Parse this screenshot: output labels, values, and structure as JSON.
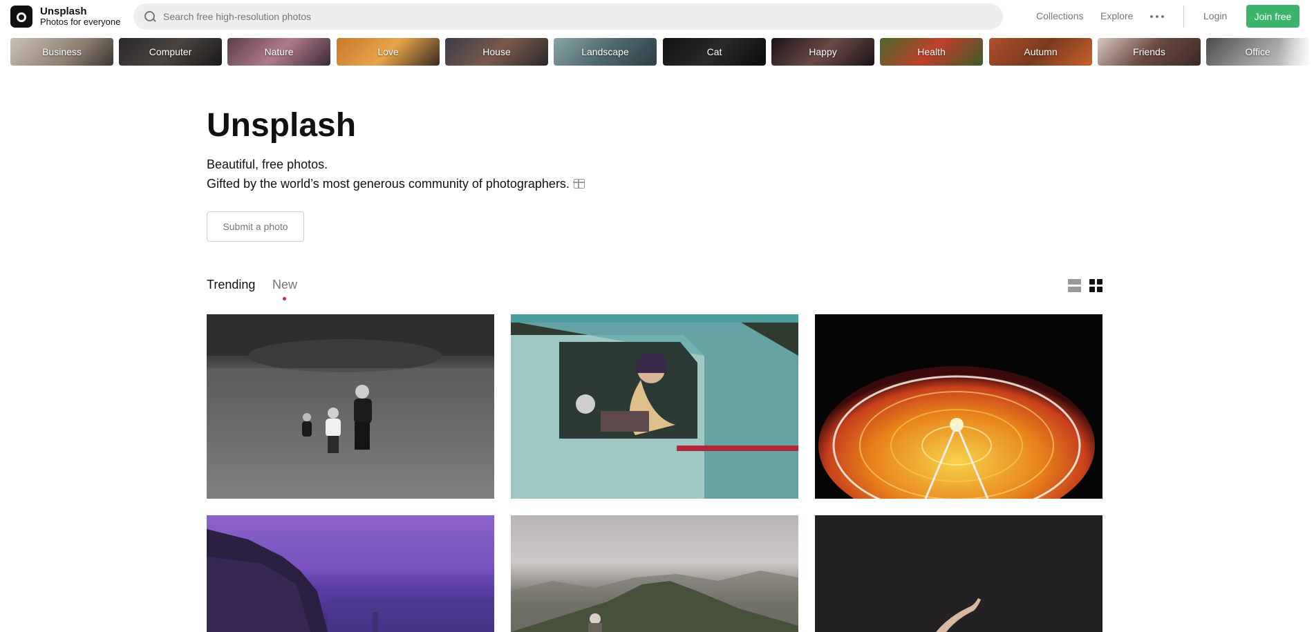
{
  "brand": {
    "title": "Unsplash",
    "subtitle": "Photos for everyone"
  },
  "search": {
    "placeholder": "Search free high-resolution photos"
  },
  "nav": {
    "collections": "Collections",
    "explore": "Explore",
    "login": "Login",
    "join": "Join free"
  },
  "topics": [
    "Business",
    "Computer",
    "Nature",
    "Love",
    "House",
    "Landscape",
    "Cat",
    "Happy",
    "Health",
    "Autumn",
    "Friends",
    "Office"
  ],
  "hero": {
    "title": "Unsplash",
    "line1": "Beautiful, free photos.",
    "line2": "Gifted by the world’s most generous community of photographers.",
    "submit": "Submit a photo"
  },
  "tabs": {
    "trending": "Trending",
    "new": "New"
  },
  "colors": {
    "accent": "#3cb46e",
    "new_dot": "#e8184a"
  }
}
